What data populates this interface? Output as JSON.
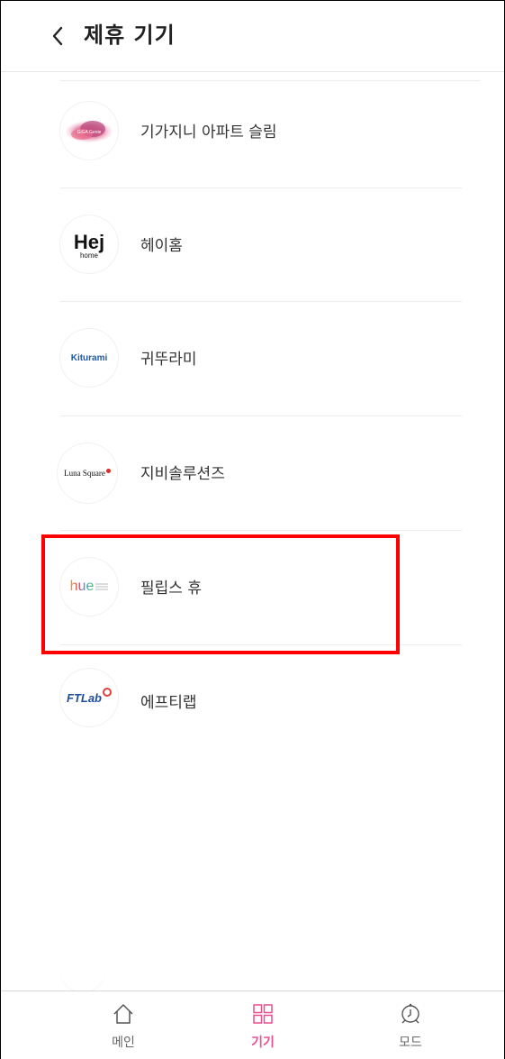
{
  "header": {
    "title": "제휴 기기",
    "back_icon": "chevron-left-icon"
  },
  "devices": [
    {
      "name": "기가지니 아파트 슬림",
      "logo": "giga-genie-logo",
      "logo_text": "GiGA Genie"
    },
    {
      "name": "헤이홈",
      "logo": "hej-home-logo",
      "logo_text": "Hej",
      "logo_subtext": "home"
    },
    {
      "name": "귀뚜라미",
      "logo": "kiturami-logo",
      "logo_text": "Kiturami"
    },
    {
      "name": "지비솔루션즈",
      "logo": "luna-square-logo",
      "logo_text": "Luna Square"
    },
    {
      "name": "필립스 휴",
      "logo": "philips-hue-logo",
      "logo_text": "hue"
    },
    {
      "name": "에프티랩",
      "logo": "ftlab-logo",
      "logo_text": "FTLab"
    }
  ],
  "nav": {
    "items": [
      {
        "label": "메인",
        "icon": "home-icon",
        "active": false
      },
      {
        "label": "기기",
        "icon": "grid-icon",
        "active": true
      },
      {
        "label": "모드",
        "icon": "clock-icon",
        "active": false
      }
    ]
  },
  "colors": {
    "accent": "#e8508f",
    "highlight": "#ff0000",
    "text": "#333333",
    "kiturami_blue": "#1f5aa6"
  }
}
